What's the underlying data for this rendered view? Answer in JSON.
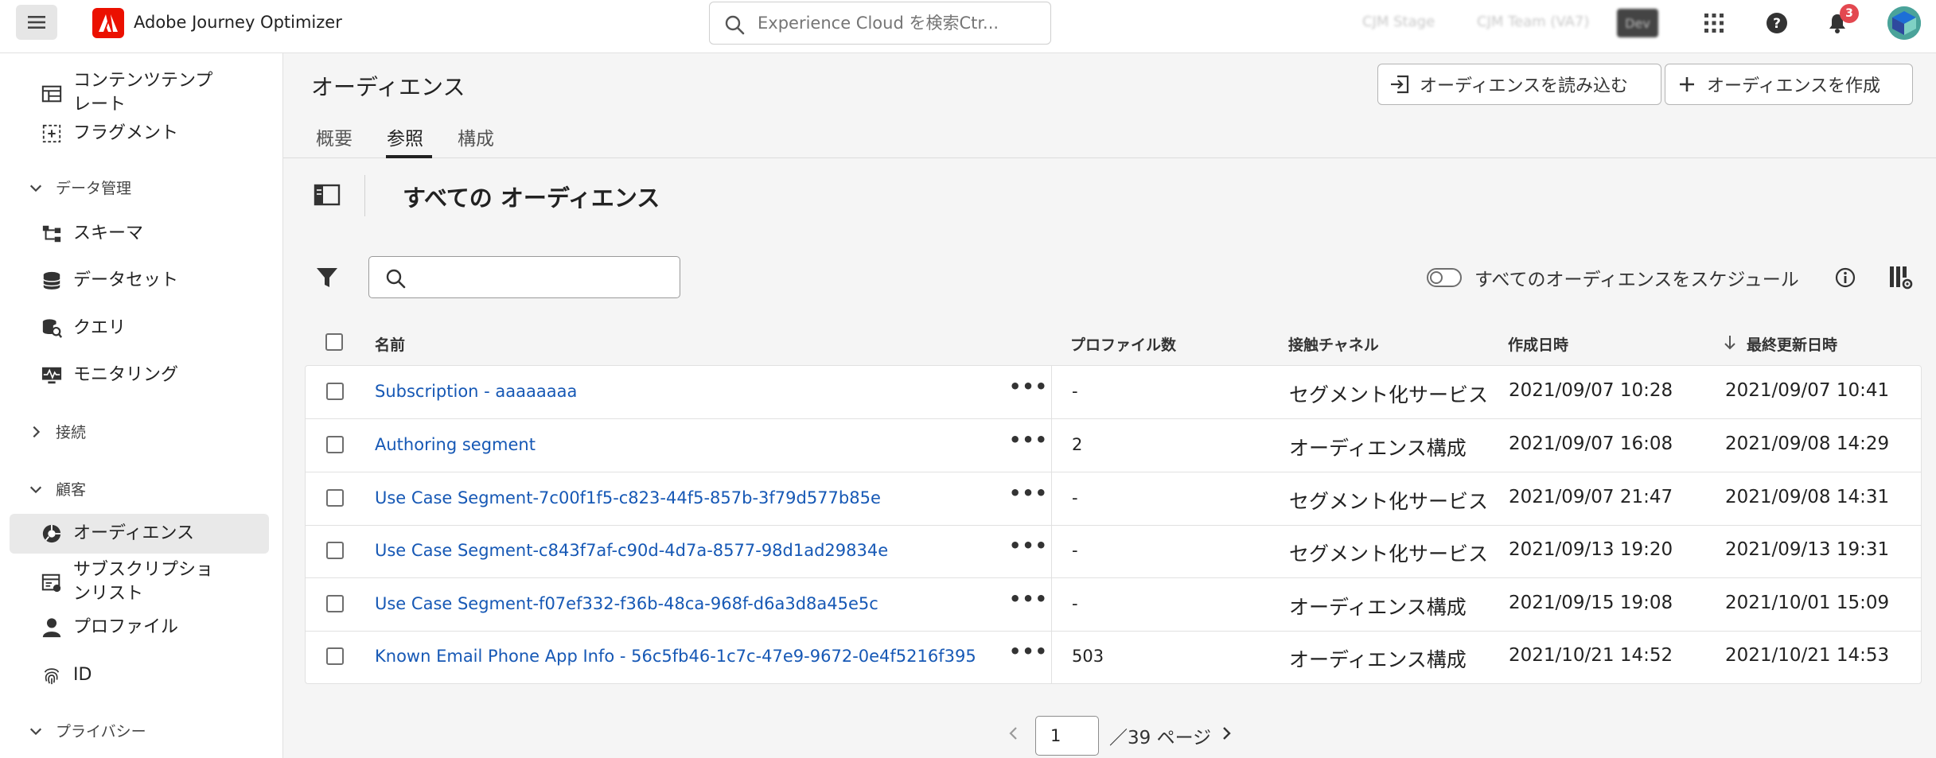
{
  "header": {
    "app_title": "Adobe Journey Optimizer",
    "search_placeholder": "Experience Cloud を検索Ctr...",
    "org_name": "CJM Stage",
    "team_name": "CJM Team (VA7)",
    "env_badge": "Dev",
    "notification_count": "3",
    "icons": [
      "menu-icon",
      "adobe-logo",
      "search-icon",
      "apps-grid-icon",
      "help-icon",
      "bell-icon",
      "avatar"
    ]
  },
  "sidebar": {
    "items": [
      {
        "label": "コンテンツテンプレート",
        "line1": "コンテンツテンプ",
        "line2": "レート",
        "icon": "template-icon"
      },
      {
        "label": "フラグメント",
        "icon": "fragment-icon"
      },
      {
        "label": "スキーマ",
        "icon": "schema-icon"
      },
      {
        "label": "データセット",
        "icon": "dataset-icon"
      },
      {
        "label": "クエリ",
        "icon": "query-icon"
      },
      {
        "label": "モニタリング",
        "icon": "monitoring-icon"
      },
      {
        "label": "オーディエンス",
        "icon": "audience-icon",
        "active": true
      },
      {
        "label": "サブスクリプションリスト",
        "line1": "サブスクリプショ",
        "line2": "ンリスト",
        "icon": "subscription-list-icon"
      },
      {
        "label": "プロファイル",
        "icon": "profile-icon"
      },
      {
        "label": "ID",
        "icon": "fingerprint-icon"
      }
    ],
    "sections": {
      "data_management": "データ管理",
      "connections": "接続",
      "customer": "顧客",
      "privacy": "プライバシー"
    }
  },
  "main": {
    "page_title": "オーディエンス",
    "import_button": "オーディエンスを読み込む",
    "create_button": "オーディエンスを作成",
    "tabs": [
      {
        "label": "概要"
      },
      {
        "label": "参照",
        "active": true
      },
      {
        "label": "構成"
      }
    ],
    "list_title": "すべての オーディエンス",
    "search_placeholder": "",
    "schedule_toggle_label": "すべてのオーディエンスをスケジュール",
    "schedule_toggle_on": false
  },
  "table": {
    "columns": {
      "name": "名前",
      "profiles": "プロファイル数",
      "channel": "接触チャネル",
      "created": "作成日時",
      "updated": "最終更新日時"
    },
    "sort_column": "updated",
    "sort_direction": "descending",
    "rows": [
      {
        "name": "Subscription - aaaaaaaa",
        "profiles": "-",
        "channel": "セグメント化サービス",
        "created": "2021/09/07 10:28",
        "updated": "2021/09/07 10:41"
      },
      {
        "name": "Authoring segment",
        "profiles": "2",
        "channel": "オーディエンス構成",
        "created": "2021/09/07 16:08",
        "updated": "2021/09/08 14:29"
      },
      {
        "name": "Use Case Segment-7c00f1f5-c823-44f5-857b-3f79d577b85e",
        "profiles": "-",
        "channel": "セグメント化サービス",
        "created": "2021/09/07 21:47",
        "updated": "2021/09/08 14:31"
      },
      {
        "name": "Use Case Segment-c843f7af-c90d-4d7a-8577-98d1ad29834e",
        "profiles": "-",
        "channel": "セグメント化サービス",
        "created": "2021/09/13 19:20",
        "updated": "2021/09/13 19:31"
      },
      {
        "name": "Use Case Segment-f07ef332-f36b-48ca-968f-d6a3d8a45e5c",
        "profiles": "-",
        "channel": "オーディエンス構成",
        "created": "2021/09/15 19:08",
        "updated": "2021/10/01 15:09"
      },
      {
        "name": "Known Email Phone App Info - 56c5fb46-1c7c-47e9-9672-0e4f5216f395",
        "profiles": "503",
        "channel": "オーディエンス構成",
        "created": "2021/10/21 14:52",
        "updated": "2021/10/21 14:53"
      }
    ],
    "row_menu_label": "•••"
  },
  "pagination": {
    "current_page": "1",
    "total_label": "／39 ページ"
  }
}
